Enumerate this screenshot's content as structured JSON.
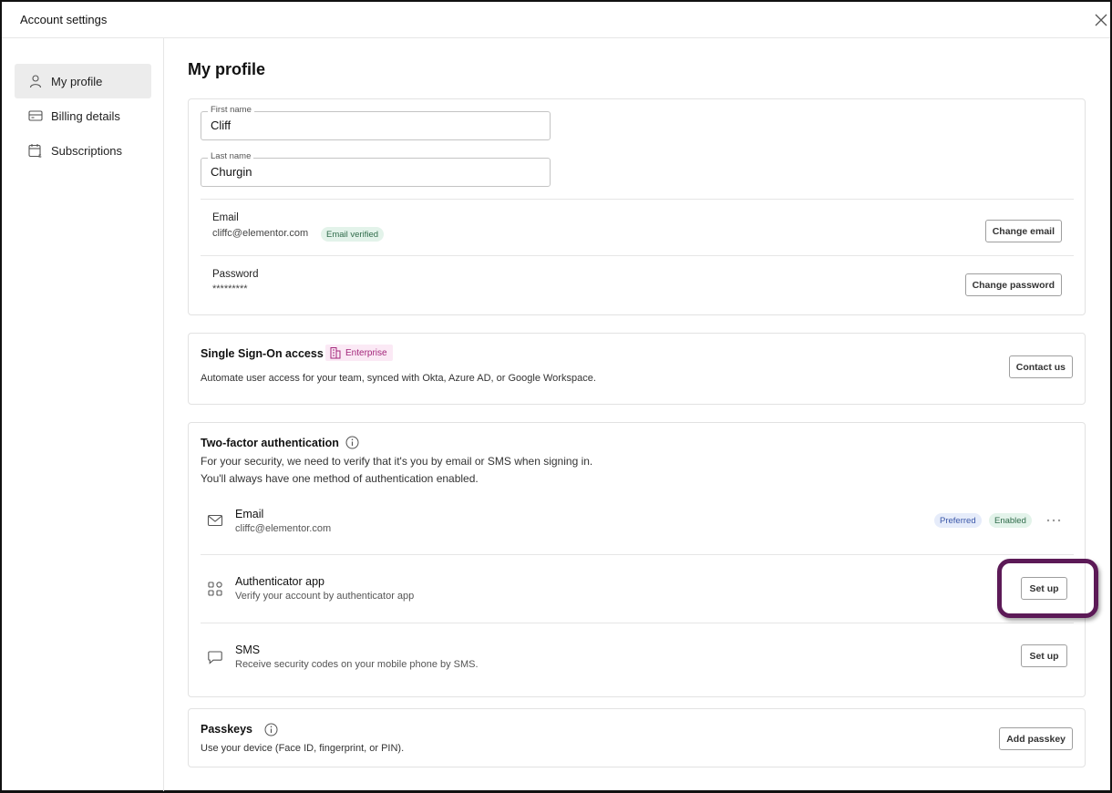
{
  "window": {
    "title": "Account settings"
  },
  "sidebar": {
    "items": [
      {
        "label": "My profile",
        "icon": "person-icon",
        "active": true
      },
      {
        "label": "Billing details",
        "icon": "credit-card-icon",
        "active": false
      },
      {
        "label": "Subscriptions",
        "icon": "calendar-dollar-icon",
        "active": false
      }
    ]
  },
  "page": {
    "title": "My profile"
  },
  "profile": {
    "first_name_label": "First name",
    "first_name_value": "Cliff",
    "last_name_label": "Last name",
    "last_name_value": "Churgin",
    "email_label": "Email",
    "email_value": "cliffc@elementor.com",
    "email_badge": "Email verified",
    "change_email_label": "Change email",
    "password_label": "Password",
    "password_value": "*********",
    "change_password_label": "Change password"
  },
  "sso": {
    "title": "Single Sign-On access",
    "badge": "Enterprise",
    "description": "Automate user access for your team, synced with Okta, Azure AD, or Google Workspace.",
    "button_label": "Contact us"
  },
  "two_factor": {
    "title": "Two-factor authentication",
    "description_line1": "For your security, we need to verify that it's you by email or SMS when signing in.",
    "description_line2": "You'll always have one method of authentication enabled.",
    "methods": [
      {
        "title": "Email",
        "subtitle": "cliffc@elementor.com",
        "icon": "mail-icon",
        "badges": [
          "Preferred",
          "Enabled"
        ]
      },
      {
        "title": "Authenticator app",
        "subtitle": "Verify your account by authenticator app",
        "icon": "apps-grid-icon",
        "button_label": "Set up"
      },
      {
        "title": "SMS",
        "subtitle": "Receive security codes on your mobile phone by SMS.",
        "icon": "chat-bubble-icon",
        "button_label": "Set up"
      }
    ]
  },
  "passkeys": {
    "title": "Passkeys",
    "description": "Use your device (Face ID, fingerprint, or PIN).",
    "button_label": "Add passkey"
  },
  "colors": {
    "highlight": "#5c1a57",
    "verified_badge_bg": "#e3f3ea",
    "preferred_badge_bg": "#e6ecfa",
    "enterprise_badge_bg": "#fbe9f5",
    "active_nav_bg": "#ececec"
  }
}
